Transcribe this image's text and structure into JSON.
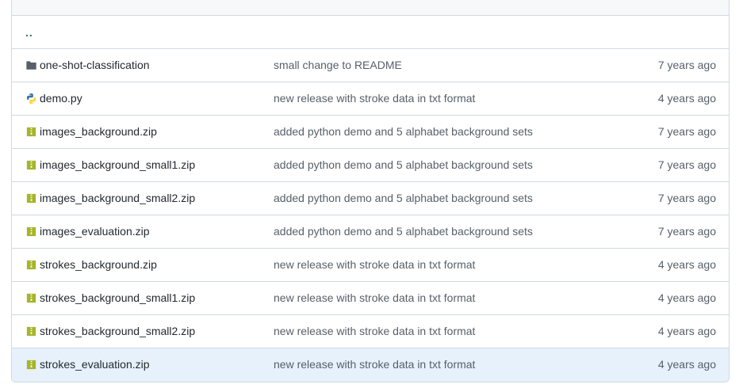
{
  "parent_link": "..",
  "colors": {
    "folder_icon": "#57606a",
    "zip_icon": "#a6b52a",
    "python_blue": "#3776ab",
    "python_yellow": "#ffd43b",
    "highlight_row": "#e6f1fb"
  },
  "rows": [
    {
      "name": "one-shot-classification",
      "icon": "folder-icon",
      "message": "small change to README",
      "age": "7 years ago"
    },
    {
      "name": "demo.py",
      "icon": "python-file-icon",
      "message": "new release with stroke data in txt format",
      "age": "4 years ago"
    },
    {
      "name": "images_background.zip",
      "icon": "zip-file-icon",
      "message": "added python demo and 5 alphabet background sets",
      "age": "7 years ago"
    },
    {
      "name": "images_background_small1.zip",
      "icon": "zip-file-icon",
      "message": "added python demo and 5 alphabet background sets",
      "age": "7 years ago"
    },
    {
      "name": "images_background_small2.zip",
      "icon": "zip-file-icon",
      "message": "added python demo and 5 alphabet background sets",
      "age": "7 years ago"
    },
    {
      "name": "images_evaluation.zip",
      "icon": "zip-file-icon",
      "message": "added python demo and 5 alphabet background sets",
      "age": "7 years ago"
    },
    {
      "name": "strokes_background.zip",
      "icon": "zip-file-icon",
      "message": "new release with stroke data in txt format",
      "age": "4 years ago"
    },
    {
      "name": "strokes_background_small1.zip",
      "icon": "zip-file-icon",
      "message": "new release with stroke data in txt format",
      "age": "4 years ago"
    },
    {
      "name": "strokes_background_small2.zip",
      "icon": "zip-file-icon",
      "message": "new release with stroke data in txt format",
      "age": "4 years ago"
    },
    {
      "name": "strokes_evaluation.zip",
      "icon": "zip-file-icon",
      "message": "new release with stroke data in txt format",
      "age": "4 years ago"
    }
  ]
}
